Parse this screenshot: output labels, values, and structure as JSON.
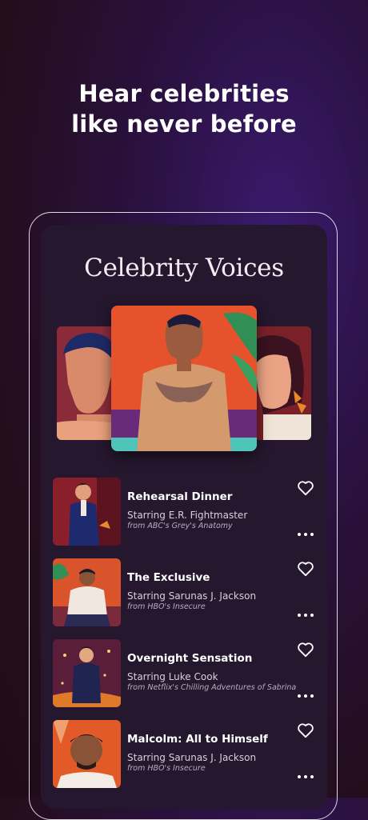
{
  "headline": {
    "line1": "Hear celebrities",
    "line2": "like never before"
  },
  "app": {
    "title": "Celebrity Voices"
  },
  "colors": {
    "background": "#240e1f",
    "card": "#25172e",
    "accent_orange": "#e8552a"
  },
  "stories": [
    {
      "title": "Rehearsal Dinner",
      "starring": "Starring E.R. Fightmaster",
      "source": "from ABC's Grey's Anatomy"
    },
    {
      "title": "The Exclusive",
      "starring": "Starring Sarunas J. Jackson",
      "source": "from HBO's Insecure"
    },
    {
      "title": "Overnight Sensation",
      "starring": "Starring Luke Cook",
      "source": "from Netflix's Chilling Adventures of Sabrina"
    },
    {
      "title": "Malcolm: All to Himself",
      "starring": "Starring Sarunas J. Jackson",
      "source": "from HBO's Insecure"
    }
  ],
  "icons": {
    "favorite": "heart-outline-icon",
    "options": "more-horizontal-icon"
  }
}
